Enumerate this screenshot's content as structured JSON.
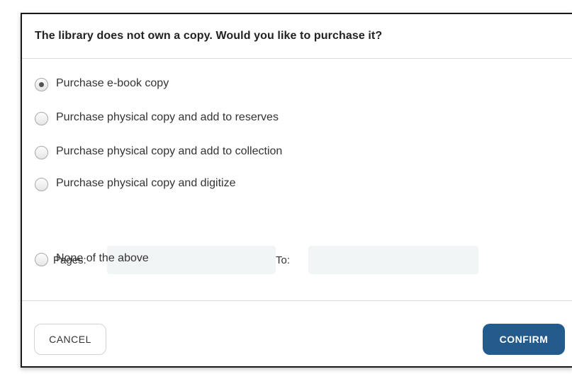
{
  "dialog": {
    "title": "The library does not own a copy. Would you like to purchase it?",
    "options": [
      {
        "label": "Purchase e-book copy",
        "selected": true
      },
      {
        "label": "Purchase physical copy and add to reserves",
        "selected": false
      },
      {
        "label": "Purchase physical copy and add to collection",
        "selected": false
      },
      {
        "label": "Purchase physical copy and digitize",
        "selected": false
      },
      {
        "label": "None of the above",
        "selected": false
      }
    ],
    "pages": {
      "from_label": "Pages:",
      "from_value": "",
      "to_label": "To:",
      "to_value": ""
    },
    "buttons": {
      "cancel": "CANCEL",
      "confirm": "CONFIRM"
    }
  },
  "colors": {
    "confirm_bg": "#235b8c",
    "field_bg": "#f1f5f5",
    "divider": "#d6dbdf"
  }
}
